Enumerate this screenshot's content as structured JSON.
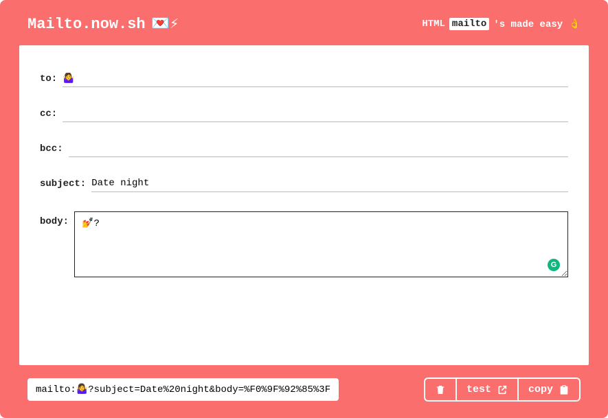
{
  "header": {
    "brand": "Mailto.now.sh",
    "brand_emoji": "💌⚡",
    "tagline_html": "HTML",
    "tagline_mailto": "mailto",
    "tagline_rest": "'s made easy 👌"
  },
  "fields": {
    "to": {
      "label": "to:",
      "value": "🤷‍♀️"
    },
    "cc": {
      "label": "cc:",
      "value": ""
    },
    "bcc": {
      "label": "bcc:",
      "value": ""
    },
    "subject": {
      "label": "subject:",
      "value": "Date night"
    },
    "body": {
      "label": "body:",
      "value": "💅?"
    }
  },
  "output": {
    "mailto_string": "mailto:🤷‍♀️?subject=Date%20night&body=%F0%9F%92%85%3F"
  },
  "buttons": {
    "test": "test",
    "copy": "copy"
  }
}
